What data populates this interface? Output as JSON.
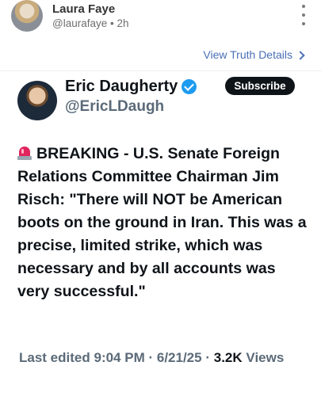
{
  "poster": {
    "name": "Laura Faye",
    "handle": "@laurafaye",
    "separator": "•",
    "time": "2h"
  },
  "actions": {
    "view_details": "View Truth Details"
  },
  "embedded_post": {
    "author_name": "Eric Daugherty",
    "author_handle": "@EricLDaugh",
    "subscribe_label": "Subscribe",
    "text": "BREAKING - U.S. Senate Foreign Relations Committee Chairman Jim Risch: \"There will NOT be American boots on the ground in Iran. This was a precise, limited strike, which was necessary and by all accounts was very successful.\"",
    "edited_prefix": "Last edited",
    "edited_time": "9:04 PM",
    "dot": "·",
    "edited_date": "6/21/25",
    "views_count": "3.2K",
    "views_label": "Views"
  },
  "icons": {
    "more": "more-vertical-icon",
    "chevron": "chevron-right-icon",
    "verified": "verified-badge-icon",
    "siren": "rotating-light-icon"
  },
  "colors": {
    "link": "#4a6fb5",
    "verified": "#1d9bf0",
    "text": "#0f1419",
    "muted": "#5b6a78"
  }
}
